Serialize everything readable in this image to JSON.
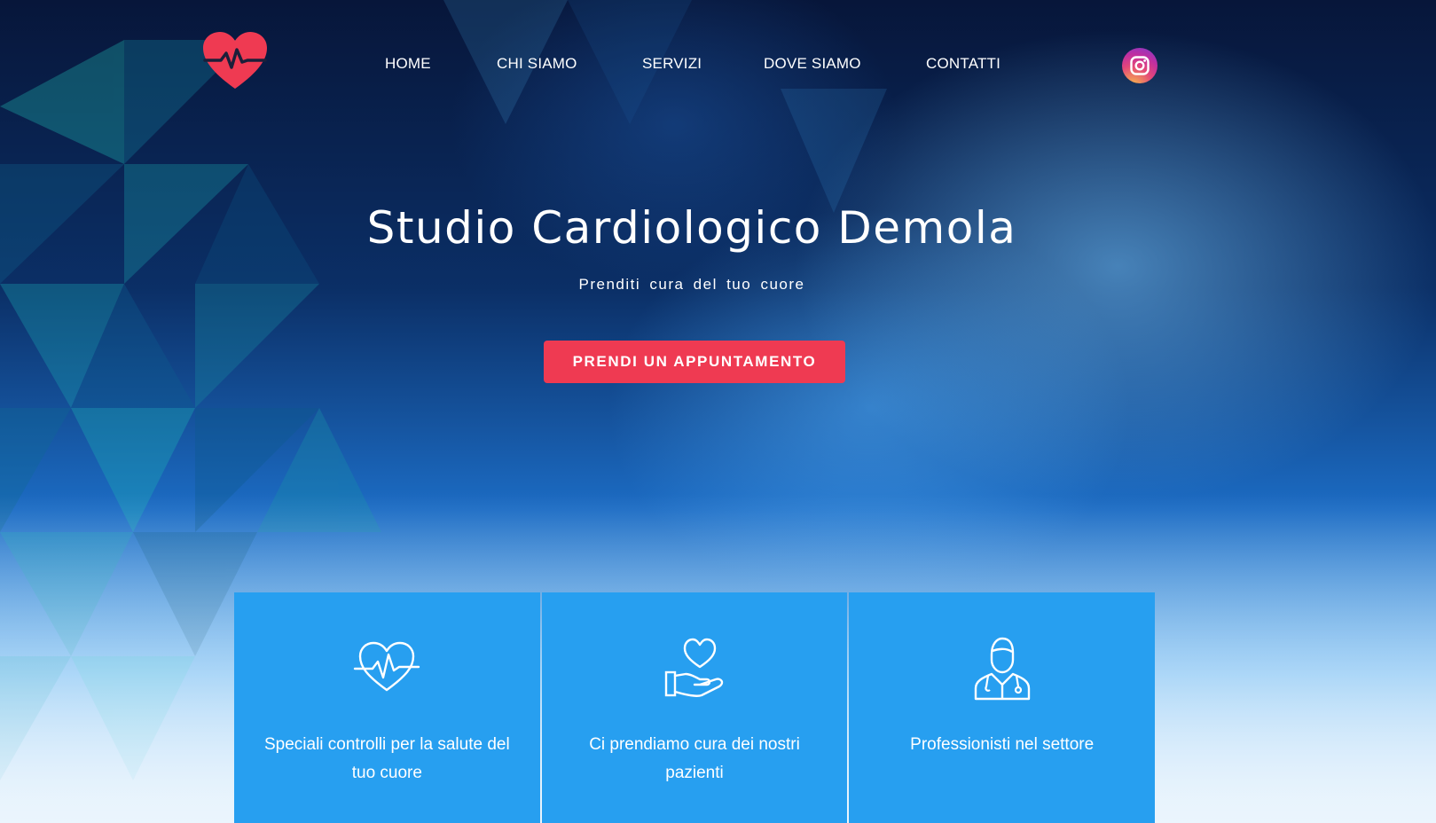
{
  "nav": {
    "items": [
      {
        "label": "HOME"
      },
      {
        "label": "CHI SIAMO"
      },
      {
        "label": "SERVIZI"
      },
      {
        "label": "DOVE SIAMO"
      },
      {
        "label": "CONTATTI"
      }
    ]
  },
  "logo": {
    "icon": "heart-pulse-icon",
    "color": "#ef3a52"
  },
  "social": {
    "icon": "instagram-icon"
  },
  "hero": {
    "title": "Studio Cardiologico Demola",
    "subtitle": "Prenditi cura del tuo cuore",
    "cta_label": "PRENDI UN APPUNTAMENTO"
  },
  "colors": {
    "accent": "#ef3a52",
    "card": "#279ff0"
  },
  "cards": [
    {
      "icon": "heart-rate-icon",
      "text": "Speciali controlli per la salute del tuo cuore"
    },
    {
      "icon": "hand-heart-icon",
      "text": "Ci prendiamo cura dei nostri pazienti"
    },
    {
      "icon": "doctor-icon",
      "text": "Professionisti nel settore"
    }
  ]
}
